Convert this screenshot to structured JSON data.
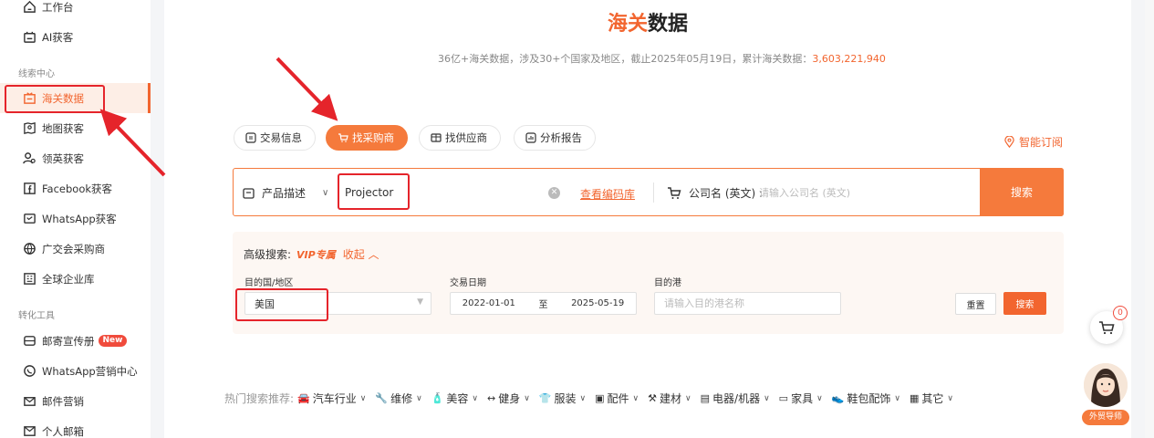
{
  "sidebar": {
    "items": [
      {
        "label": "工作台"
      },
      {
        "label": "AI获客"
      },
      {
        "label": "海关数据"
      },
      {
        "label": "地图获客"
      },
      {
        "label": "领英获客"
      },
      {
        "label": "Facebook获客"
      },
      {
        "label": "WhatsApp获客"
      },
      {
        "label": "广交会采购商"
      },
      {
        "label": "全球企业库"
      },
      {
        "label": "邮寄宣传册"
      },
      {
        "label": "WhatsApp营销中心"
      },
      {
        "label": "邮件营销"
      },
      {
        "label": "个人邮箱"
      }
    ],
    "groups": {
      "leads": "线索中心",
      "tools": "转化工具"
    },
    "new_badge": "New"
  },
  "header": {
    "title_highlight": "海关",
    "title_rest": "数据",
    "subtitle": "36亿+海关数据，涉及30+个国家及地区，截止2025年05月19日，累计海关数据：",
    "total_count": "3,603,221,940"
  },
  "tabs": [
    {
      "label": "交易信息"
    },
    {
      "label": "找采购商"
    },
    {
      "label": "找供应商"
    },
    {
      "label": "分析报告"
    }
  ],
  "smart_subscribe": "智能订阅",
  "search": {
    "type_label": "产品描述",
    "value": "Projector",
    "code_link": "查看编码库",
    "company_label": "公司名 (英文) :",
    "company_placeholder": "请输入公司名 (英文)",
    "button": "搜索"
  },
  "advanced": {
    "title": "高级搜索:",
    "vip": "VIP专属",
    "collapse": "收起",
    "country_label": "目的国/地区",
    "country_value": "美国",
    "date_label": "交易日期",
    "date_from": "2022-01-01",
    "date_sep": "至",
    "date_to": "2025-05-19",
    "port_label": "目的港",
    "port_placeholder": "请输入目的港名称",
    "reset": "重置",
    "search": "搜索"
  },
  "hot": {
    "label": "热门搜索推荐:",
    "categories": [
      "汽车行业",
      "维修",
      "美容",
      "健身",
      "服装",
      "配件",
      "建材",
      "电器/机器",
      "家具",
      "鞋包配饰",
      "其它"
    ]
  },
  "cart_count": "0",
  "advisor_label": "外贸导师",
  "colors": {
    "accent": "#f57a3c",
    "highlight_box": "#e5242b"
  }
}
